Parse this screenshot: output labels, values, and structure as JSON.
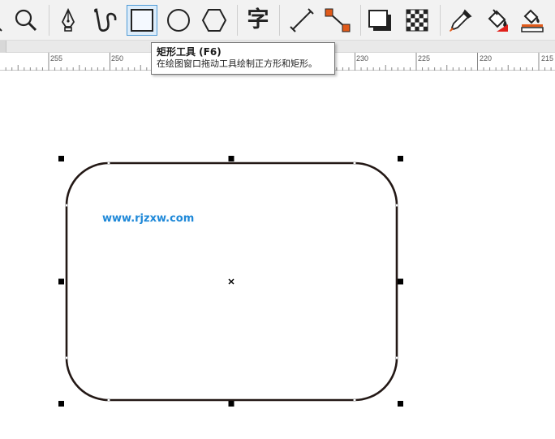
{
  "toolbar": {
    "tools": [
      {
        "id": "zoom",
        "icon": "magnifier-icon"
      },
      {
        "id": "freehand",
        "icon": "pen-nib-icon"
      },
      {
        "id": "artistic",
        "icon": "hook-curve-icon"
      },
      {
        "id": "rectangle",
        "icon": "rectangle-icon",
        "active": true
      },
      {
        "id": "ellipse",
        "icon": "ellipse-icon"
      },
      {
        "id": "polygon",
        "icon": "hexagon-icon"
      },
      {
        "id": "text",
        "icon": "text-glyph-icon",
        "label": "字"
      },
      {
        "id": "dimension",
        "icon": "dimension-line-icon"
      },
      {
        "id": "connector",
        "icon": "connector-line-icon"
      },
      {
        "id": "drop-shadow",
        "icon": "drop-shadow-icon"
      },
      {
        "id": "transparency",
        "icon": "checkerboard-icon"
      },
      {
        "id": "eyedropper",
        "icon": "eyedropper-icon"
      },
      {
        "id": "interactive-fill",
        "icon": "fill-bucket-icon"
      },
      {
        "id": "smart-fill",
        "icon": "smart-fill-icon"
      }
    ],
    "accent_color": "#e05a1a"
  },
  "ruler": {
    "labels": [
      "255",
      "250",
      "230",
      "225",
      "220",
      "215"
    ]
  },
  "tooltip": {
    "title": "矩形工具 (F6)",
    "description": "在绘图窗口拖动工具绘制正方形和矩形。"
  },
  "canvas": {
    "watermark": "www.rjzxw.com",
    "shape": "rounded-rectangle",
    "selected": true
  }
}
